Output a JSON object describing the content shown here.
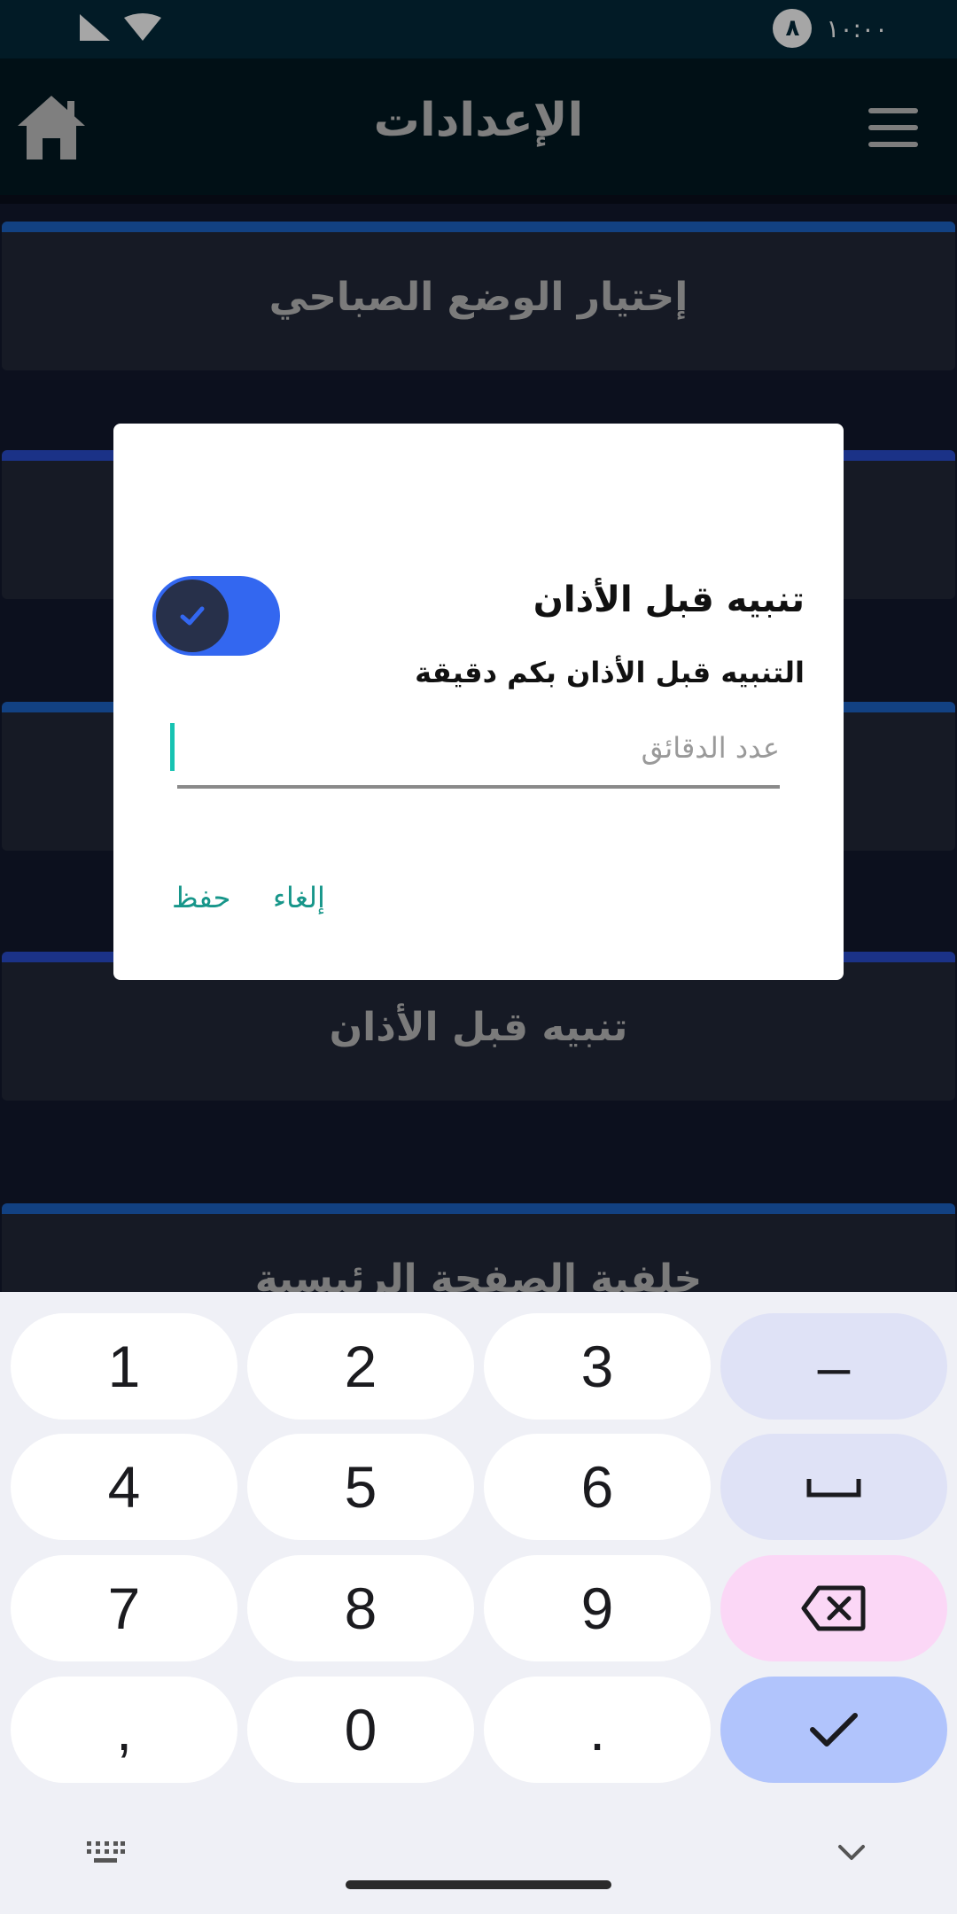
{
  "status_bar": {
    "time": "١٠:٠٠",
    "badge": "٨",
    "icons": [
      "signal-icon",
      "wifi-icon"
    ]
  },
  "app_bar": {
    "title": "الإعدادات",
    "home_icon": "home-icon",
    "menu_icon": "hamburger-menu-icon"
  },
  "settings": {
    "items": [
      {
        "label": "إختيار الوضع الصباحي"
      },
      {
        "label": ""
      },
      {
        "label": ""
      },
      {
        "label": "تنبيه قبل الأذان"
      },
      {
        "label": "خلفية الصفحة الرئيسية"
      }
    ]
  },
  "dialog": {
    "title": "تنبيه قبل الأذان",
    "subtitle": "التنبيه قبل الأذان بكم دقيقة",
    "toggle_on": true,
    "input_placeholder": "عدد الدقائق",
    "input_value": "",
    "cancel_label": "إلغاء",
    "save_label": "حفظ"
  },
  "keyboard": {
    "rows": [
      [
        "1",
        "2",
        "3",
        "–"
      ],
      [
        "4",
        "5",
        "6",
        "␣"
      ],
      [
        "7",
        "8",
        "9",
        "⌫"
      ],
      [
        ",",
        "0",
        ".",
        "✓"
      ]
    ]
  },
  "colors": {
    "status_bar": "#042a3b",
    "app_bar": "#021923",
    "card": "#222939",
    "card_accent": "#1d64c8",
    "toggle": "#3367f0",
    "dialog_button": "#17968a"
  }
}
